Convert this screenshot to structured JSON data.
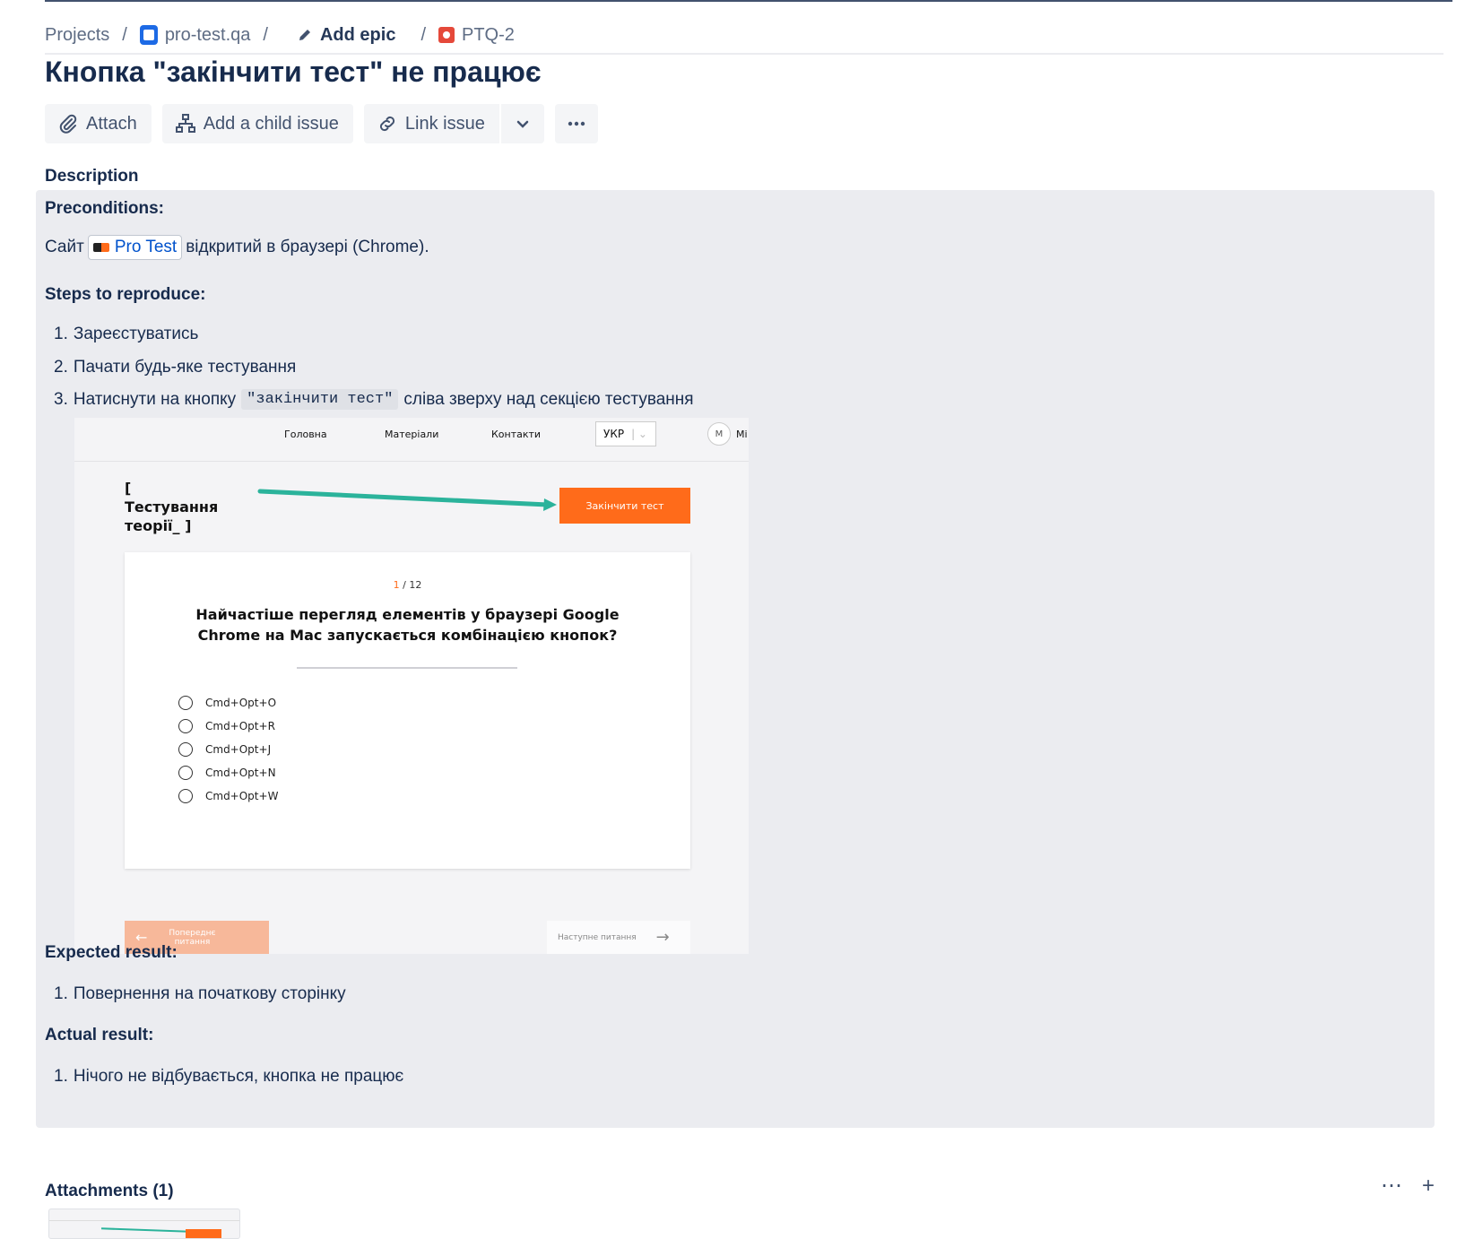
{
  "breadcrumb": {
    "projects": "Projects",
    "project": "pro-test.qa",
    "epic": "Add epic",
    "issue_key": "PTQ-2"
  },
  "issue": {
    "title": "Кнопка \"закінчити тест\" не працює"
  },
  "toolbar": {
    "attach": "Attach",
    "add_child": "Add a child issue",
    "link_issue": "Link issue"
  },
  "description": {
    "label": "Description",
    "preconditions_heading": "Preconditions:",
    "site_prefix": "Сайт",
    "site_link": "Pro Test",
    "site_suffix": "відкритий в браузері (Chrome).",
    "steps_heading": "Steps to reproduce:",
    "steps": [
      {
        "num": "1.",
        "text": "Зареєстуватись"
      },
      {
        "num": "2.",
        "text": "Пачати будь-яке тестування"
      },
      {
        "num": "3.",
        "text_before": "Натиснути на кнопку",
        "code": "\"закінчити тест\"",
        "text_after": "сліва зверху над секцією тестування"
      }
    ],
    "expected_heading": "Expected result:",
    "expected": [
      {
        "num": "1.",
        "text": "Повернення на початкову сторінку"
      }
    ],
    "actual_heading": "Actual result:",
    "actual": [
      {
        "num": "1.",
        "text": "Нічого не відбувається, кнопка не працює"
      }
    ]
  },
  "screenshot": {
    "nav": [
      "Головна",
      "Матеріали",
      "Контакти"
    ],
    "lang": "УКР",
    "avatar": "М",
    "avatar_name": "Mi",
    "test_title": "[\nТестування\nтеорії_ ]",
    "finish_button": "Закінчити тест",
    "counter_current": "1",
    "counter_total": "/ 12",
    "question": "Найчастіше перегляд елементів у браузері Google Chrome на Mac запускається комбінацією кнопок?",
    "options": [
      "Cmd+Opt+O",
      "Cmd+Opt+R",
      "Cmd+Opt+J",
      "Cmd+Opt+N",
      "Cmd+Opt+W"
    ],
    "prev_button": "Попереднє питання",
    "next_button": "Наступне питання"
  },
  "attachments": {
    "label": "Attachments (1)"
  },
  "colors": {
    "accent_orange": "#ff6b1a",
    "arrow_teal": "#2bb39b",
    "link_blue": "#0052cc"
  }
}
